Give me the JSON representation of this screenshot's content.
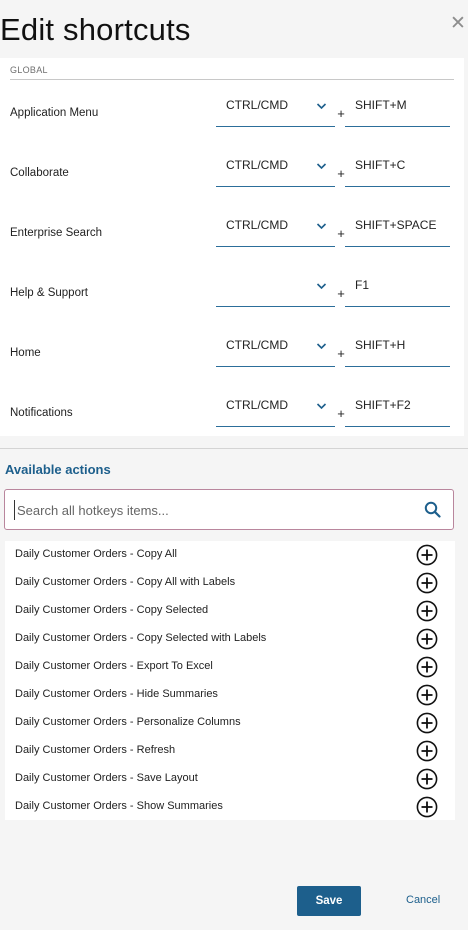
{
  "dialog": {
    "title": "Edit shortcuts",
    "close_icon": "close-icon"
  },
  "global": {
    "section_label": "GLOBAL",
    "shortcuts": [
      {
        "name": "Application Menu",
        "modifier": "CTRL/CMD",
        "key": "SHIFT+M"
      },
      {
        "name": "Collaborate",
        "modifier": "CTRL/CMD",
        "key": "SHIFT+C"
      },
      {
        "name": "Enterprise Search",
        "modifier": "CTRL/CMD",
        "key": "SHIFT+SPACE"
      },
      {
        "name": "Help & Support",
        "modifier": "",
        "key": "F1"
      },
      {
        "name": "Home",
        "modifier": "CTRL/CMD",
        "key": "SHIFT+H"
      },
      {
        "name": "Notifications",
        "modifier": "CTRL/CMD",
        "key": "SHIFT+F2"
      }
    ],
    "plus_sign": "+"
  },
  "available": {
    "heading": "Available actions",
    "search": {
      "placeholder": "Search all hotkeys items...",
      "value": "",
      "icon": "search-icon"
    },
    "actions": [
      "Daily Customer Orders - Copy All",
      "Daily Customer Orders - Copy All with Labels",
      "Daily Customer Orders - Copy Selected",
      "Daily Customer Orders - Copy Selected with Labels",
      "Daily Customer Orders - Export To Excel",
      "Daily Customer Orders - Hide Summaries",
      "Daily Customer Orders - Personalize Columns",
      "Daily Customer Orders - Refresh",
      "Daily Customer Orders - Save Layout",
      "Daily Customer Orders - Show Summaries"
    ],
    "add_icon": "add-circle-icon"
  },
  "footer": {
    "save_label": "Save",
    "cancel_label": "Cancel"
  },
  "colors": {
    "accent": "#1d5f8c",
    "background": "#f5f5f5",
    "panel": "#ffffff",
    "search_border": "#b9869d"
  }
}
